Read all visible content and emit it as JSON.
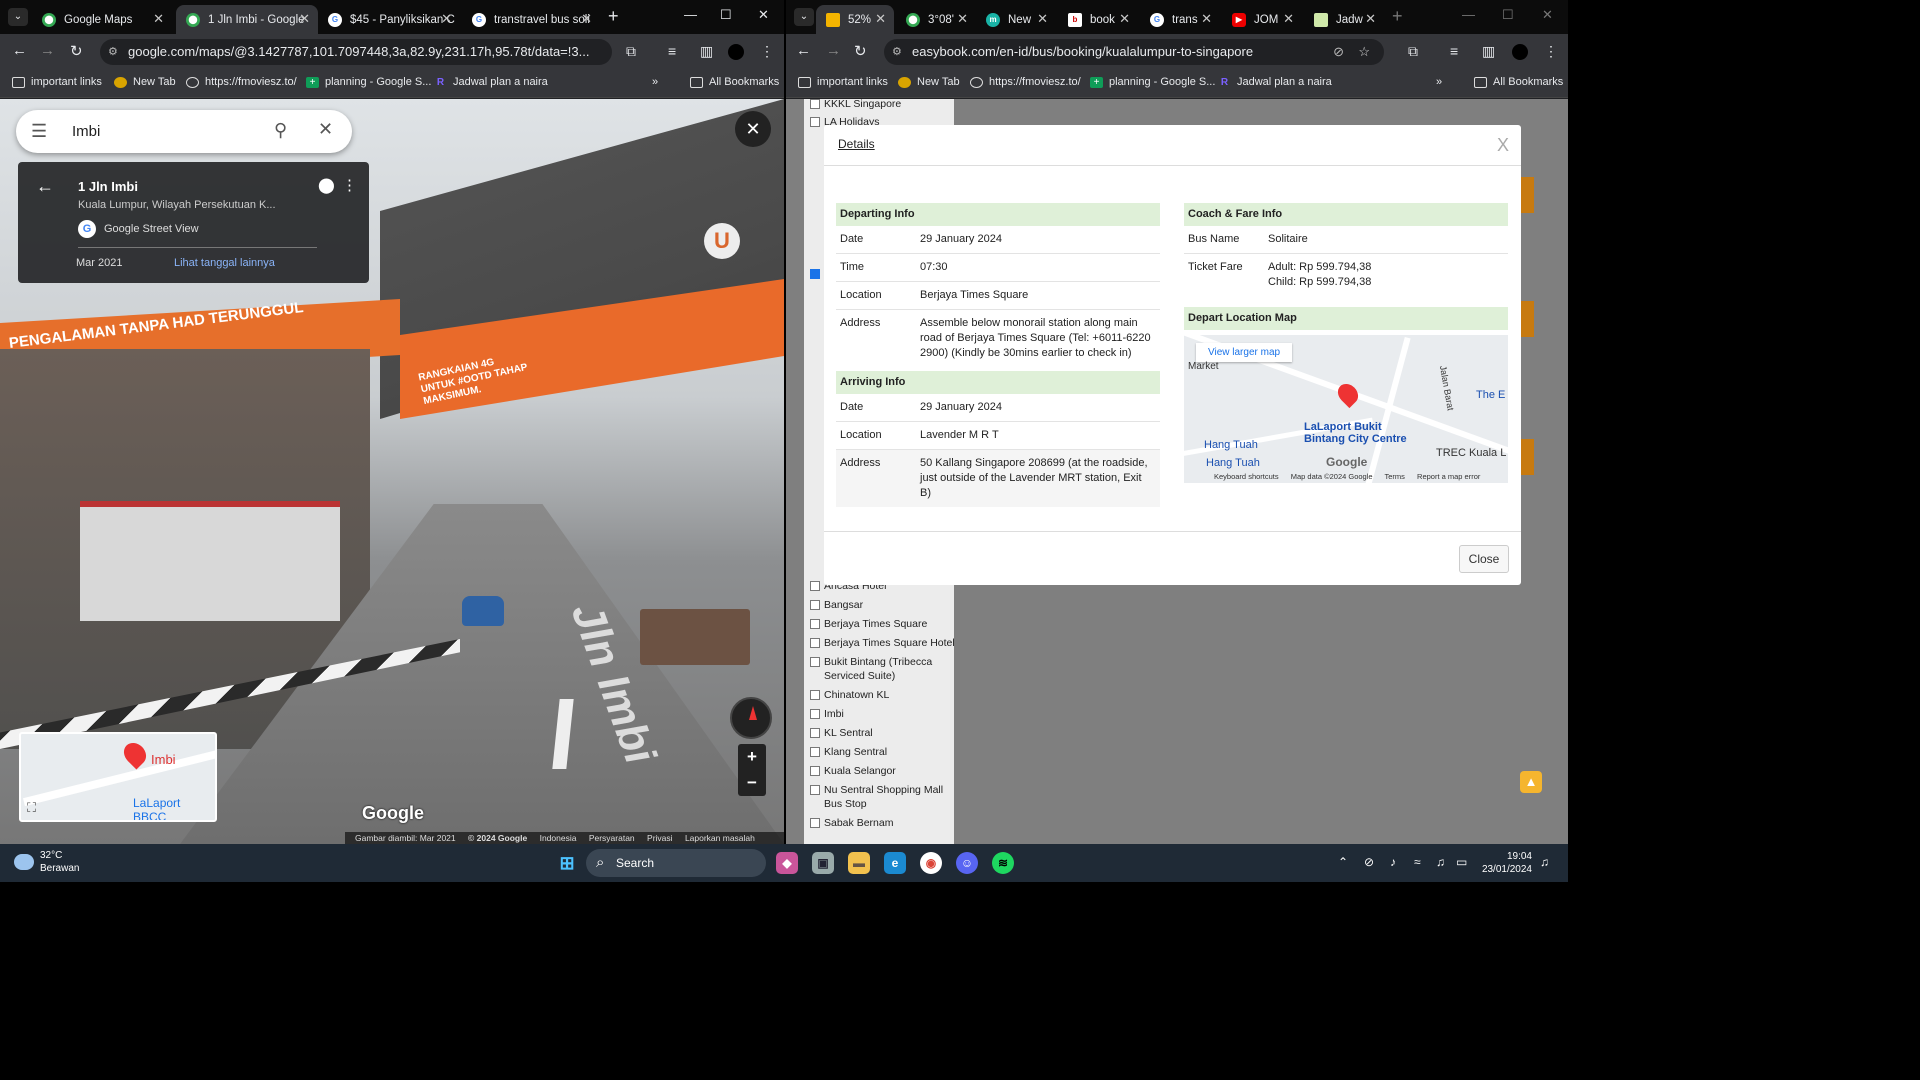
{
  "left_window": {
    "tabs": [
      {
        "title": "Google Maps",
        "active": false
      },
      {
        "title": "1 Jln Imbi - Google",
        "active": true
      },
      {
        "title": "$45 - Panyliksikan C",
        "active": false
      },
      {
        "title": "transtravel bus soli",
        "active": false
      }
    ],
    "address": "google.com/maps/@3.1427787,101.7097448,3a,82.9y,231.17h,95.78t/data=!3...",
    "bookmarks": [
      "important links",
      "New Tab",
      "https://fmoviesz.to/",
      "planning - Google S...",
      "Jadwal plan a naira"
    ],
    "all_bookmarks": "All Bookmarks",
    "search_query": "Imbi",
    "place_title": "1 Jln Imbi",
    "place_subtitle": "Kuala Lumpur, Wilayah Persekutuan K...",
    "source": "Google Street View",
    "capture_date": "Mar 2021",
    "more_dates": "Lihat tanggal lainnya",
    "minimap_label_1": "Imbi",
    "minimap_label_2": "LaLaport BBCC",
    "watermark": "Google",
    "scene_text_left": "PENGALAMAN TANPA HAD TERUNGGUL",
    "scene_text_banner": "RANGKAIAN 4G UNTUK #OOTD TAHAP MAKSIMUM.",
    "scene_road_text": "Jln Imbi",
    "footer": [
      "Gambar diambil: Mar 2021",
      "© 2024 Google",
      "Indonesia",
      "Persyaratan",
      "Privasi",
      "Laporkan masalah"
    ]
  },
  "right_window": {
    "tabs": [
      "52%",
      "3°08'",
      "New",
      "book",
      "trans",
      "JOM",
      "Jadw"
    ],
    "address": "easybook.com/en-id/bus/booking/kualalumpur-to-singapore",
    "bookmarks": [
      "important links",
      "New Tab",
      "https://fmoviesz.to/",
      "planning - Google S...",
      "Jadwal plan a naira"
    ],
    "all_bookmarks": "All Bookmarks",
    "filters_top": [
      "KKKL Singapore",
      "LA Holidays"
    ],
    "filters_bottom": [
      "Ancasa Hotel",
      "Bangsar",
      "Berjaya Times Square",
      "Berjaya Times Square Hotel",
      "Bukit Bintang (Tribecca Serviced Suite)",
      "Chinatown KL",
      "Imbi",
      "KL Sentral",
      "Klang Sentral",
      "Kuala Selangor",
      "Nu Sentral Shopping Mall Bus Stop",
      "Sabak Bernam"
    ],
    "modal": {
      "title": "Details",
      "close_x": "X",
      "departing": {
        "header": "Departing Info",
        "rows": [
          {
            "k": "Date",
            "v": "29 January 2024"
          },
          {
            "k": "Time",
            "v": "07:30"
          },
          {
            "k": "Location",
            "v": "Berjaya Times Square"
          },
          {
            "k": "Address",
            "v": "Assemble below monorail station along main road of Berjaya Times Square (Tel: +6011-6220 2900) (Kindly be 30mins earlier to check in)"
          }
        ]
      },
      "arriving": {
        "header": "Arriving Info",
        "rows": [
          {
            "k": "Date",
            "v": "29 January 2024"
          },
          {
            "k": "Location",
            "v": "Lavender M R T"
          },
          {
            "k": "Address",
            "v": "50 Kallang Singapore 208699 (at the roadside, just outside of the Lavender MRT station, Exit B)"
          }
        ]
      },
      "coach": {
        "header": "Coach & Fare Info",
        "bus_name_label": "Bus Name",
        "bus_name": "Solitaire",
        "fare_label": "Ticket Fare",
        "fare_adult": "Adult: Rp 599.794,38",
        "fare_child": "Child: Rp 599.794,38"
      },
      "map": {
        "header": "Depart Location Map",
        "view_larger": "View larger map",
        "labels": [
          "LaLaport Bukit Bintang City Centre",
          "Hang Tuah",
          "Hang Tuah",
          "TREC Kuala L",
          "Jalan Barat",
          "The E",
          "Market"
        ],
        "logo": "Google",
        "footer": [
          "Keyboard shortcuts",
          "Map data ©2024 Google",
          "Terms",
          "Report a map error"
        ]
      },
      "close_button": "Close"
    }
  },
  "taskbar": {
    "temp": "32°C",
    "weather": "Berawan",
    "search": "Search",
    "time": "19:04",
    "date": "23/01/2024"
  }
}
